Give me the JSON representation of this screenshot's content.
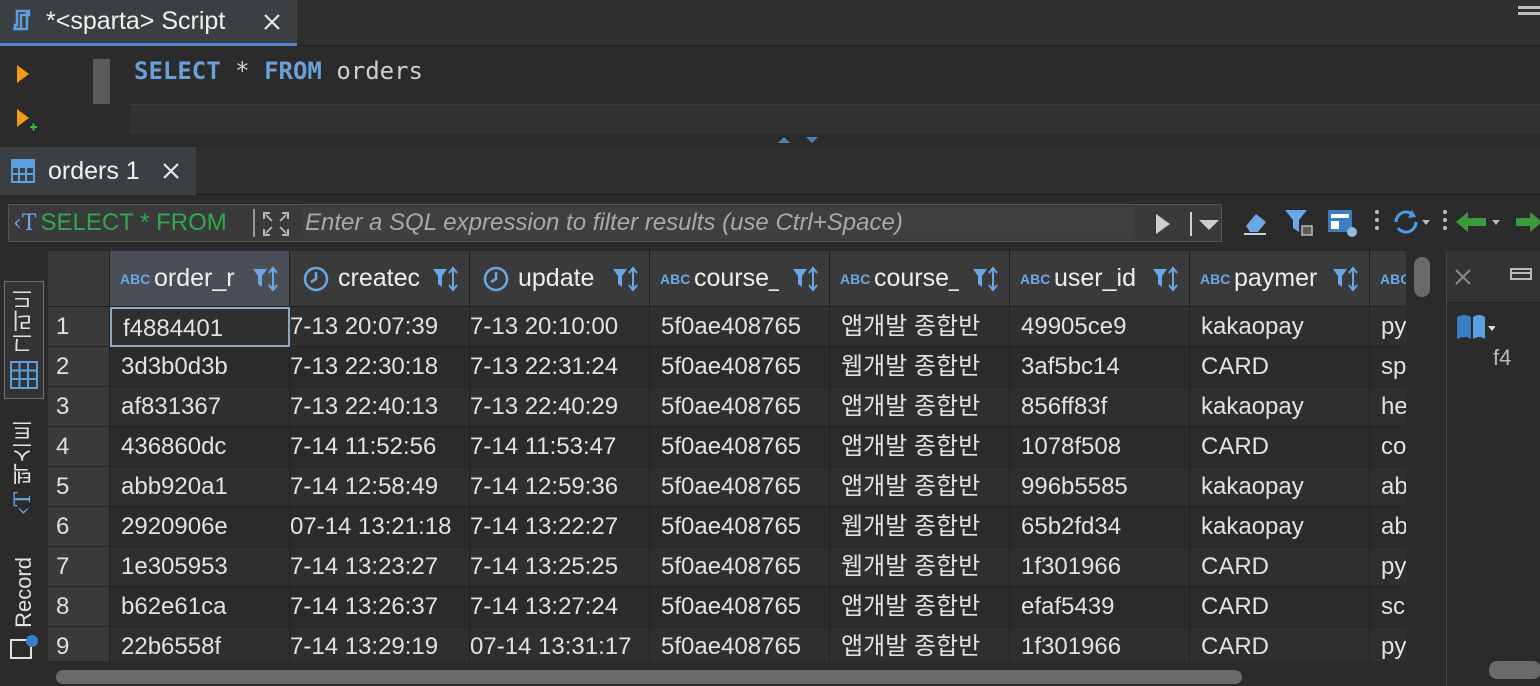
{
  "editor_tab": {
    "title": "*<sparta> Script"
  },
  "sql": {
    "select": "SELECT",
    "star": "*",
    "from": "FROM",
    "table": "orders"
  },
  "results_tab": {
    "title": "orders 1"
  },
  "filter": {
    "prefix": "SELECT * FROM",
    "placeholder": "Enter a SQL expression to filter results (use Ctrl+Space)"
  },
  "side_tabs": {
    "grid": "그리드",
    "text": "텍스트",
    "record": "Record"
  },
  "side_panel": {
    "preview": "f4"
  },
  "columns": [
    {
      "type": "ABC",
      "name": "order_r"
    },
    {
      "type": "clock",
      "name": "createc"
    },
    {
      "type": "clock",
      "name": "update"
    },
    {
      "type": "ABC",
      "name": "course_"
    },
    {
      "type": "ABC",
      "name": "course_"
    },
    {
      "type": "ABC",
      "name": "user_id"
    },
    {
      "type": "ABC",
      "name": "paymer"
    },
    {
      "type": "ABC",
      "name": ""
    }
  ],
  "rows": [
    {
      "n": "1",
      "order": "f4884401",
      "created": "7-13 20:07:39",
      "updated": "7-13 20:10:00",
      "course_id": "5f0ae408765",
      "course_title": "앱개발 종합반",
      "user_id": "49905ce9",
      "payment": "kakaopay",
      "extra": "py"
    },
    {
      "n": "2",
      "order": "3d3b0d3b",
      "created": "7-13 22:30:18",
      "updated": "7-13 22:31:24",
      "course_id": "5f0ae408765",
      "course_title": "웹개발 종합반",
      "user_id": "3af5bc14",
      "payment": "CARD",
      "extra": "sp"
    },
    {
      "n": "3",
      "order": "af831367",
      "created": "7-13 22:40:13",
      "updated": "7-13 22:40:29",
      "course_id": "5f0ae408765",
      "course_title": "앱개발 종합반",
      "user_id": "856ff83f",
      "payment": "kakaopay",
      "extra": "he"
    },
    {
      "n": "4",
      "order": "436860dc",
      "created": "7-14 11:52:56",
      "updated": "7-14 11:53:47",
      "course_id": "5f0ae408765",
      "course_title": "앱개발 종합반",
      "user_id": "1078f508",
      "payment": "CARD",
      "extra": "co"
    },
    {
      "n": "5",
      "order": "abb920a1",
      "created": "7-14 12:58:49",
      "updated": "7-14 12:59:36",
      "course_id": "5f0ae408765",
      "course_title": "앱개발 종합반",
      "user_id": "996b5585",
      "payment": "kakaopay",
      "extra": "ab"
    },
    {
      "n": "6",
      "order": "2920906e",
      "created": "07-14 13:21:18",
      "updated": "7-14 13:22:27",
      "course_id": "5f0ae408765",
      "course_title": "웹개발 종합반",
      "user_id": "65b2fd34",
      "payment": "kakaopay",
      "extra": "ab"
    },
    {
      "n": "7",
      "order": "1e305953",
      "created": "7-14 13:23:27",
      "updated": "7-14 13:25:25",
      "course_id": "5f0ae408765",
      "course_title": "웹개발 종합반",
      "user_id": "1f301966",
      "payment": "CARD",
      "extra": "py"
    },
    {
      "n": "8",
      "order": "b62e61ca",
      "created": "7-14 13:26:37",
      "updated": "7-14 13:27:24",
      "course_id": "5f0ae408765",
      "course_title": "앱개발 종합반",
      "user_id": "efaf5439",
      "payment": "CARD",
      "extra": "sc"
    },
    {
      "n": "9",
      "order": "22b6558f",
      "created": "7-14 13:29:19",
      "updated": "07-14 13:31:17",
      "course_id": "5f0ae408765",
      "course_title": "앱개발 종합반",
      "user_id": "1f301966",
      "payment": "CARD",
      "extra": "py"
    }
  ]
}
